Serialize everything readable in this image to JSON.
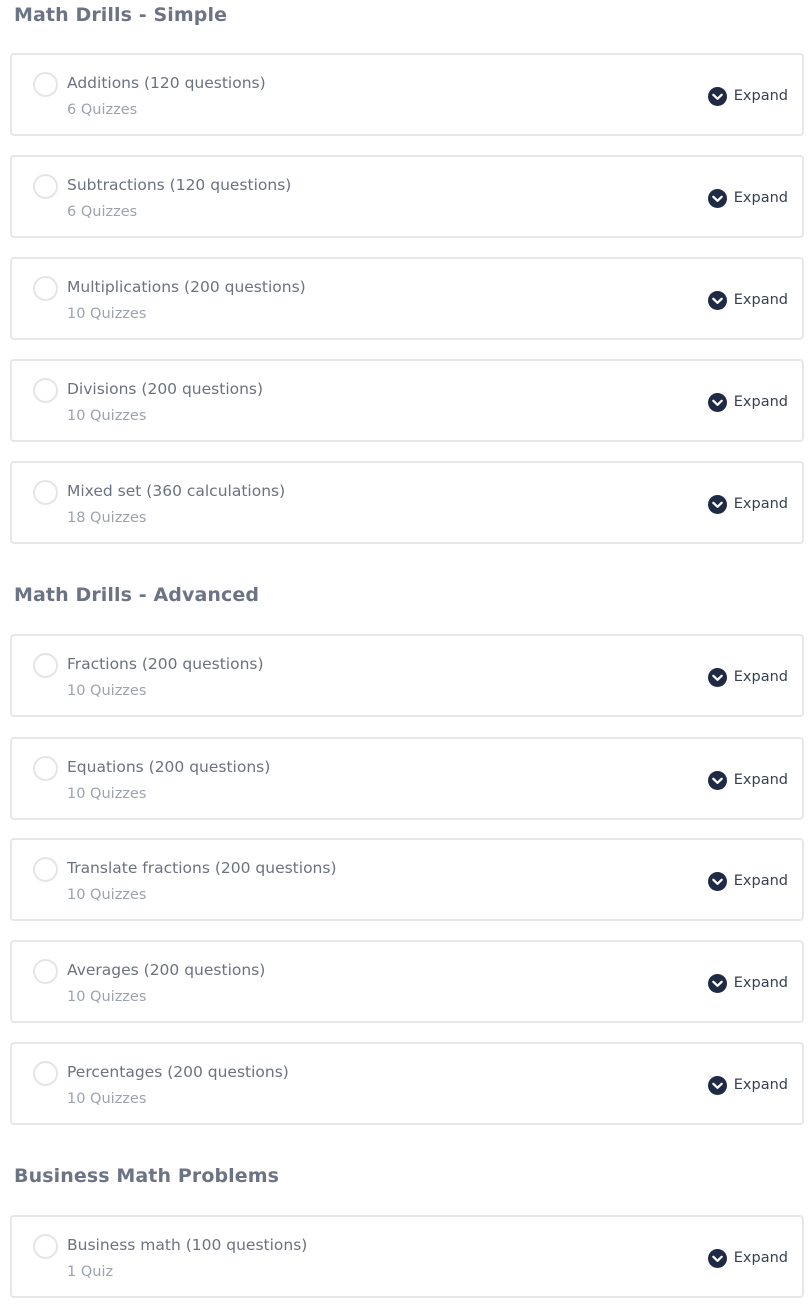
{
  "sections": [
    {
      "title": "Math Drills - Simple",
      "items": [
        {
          "title": "Additions (120 questions)",
          "subtitle": "6 Quizzes",
          "action": "Expand"
        },
        {
          "title": "Subtractions (120 questions)",
          "subtitle": "6 Quizzes",
          "action": "Expand"
        },
        {
          "title": "Multiplications (200 questions)",
          "subtitle": "10 Quizzes",
          "action": "Expand"
        },
        {
          "title": "Divisions (200 questions)",
          "subtitle": "10 Quizzes",
          "action": "Expand"
        },
        {
          "title": "Mixed set (360 calculations)",
          "subtitle": "18 Quizzes",
          "action": "Expand"
        }
      ]
    },
    {
      "title": "Math Drills - Advanced",
      "items": [
        {
          "title": "Fractions (200 questions)",
          "subtitle": "10 Quizzes",
          "action": "Expand"
        },
        {
          "title": "Equations (200 questions)",
          "subtitle": "10 Quizzes",
          "action": "Expand"
        },
        {
          "title": "Translate fractions (200 questions)",
          "subtitle": "10 Quizzes",
          "action": "Expand"
        },
        {
          "title": "Averages (200 questions)",
          "subtitle": "10 Quizzes",
          "action": "Expand"
        },
        {
          "title": "Percentages (200 questions)",
          "subtitle": "10 Quizzes",
          "action": "Expand"
        }
      ]
    },
    {
      "title": "Business Math Problems",
      "items": [
        {
          "title": "Business math (100 questions)",
          "subtitle": "1 Quiz",
          "action": "Expand"
        }
      ]
    }
  ],
  "icons": {
    "status": "radio-circle-icon",
    "expand": "chevron-down-circle-icon"
  },
  "colors": {
    "section_title": "#6b7385",
    "card_border": "#e5e7eb",
    "expand_icon": "#1f2a44",
    "expand_label": "#374151"
  }
}
